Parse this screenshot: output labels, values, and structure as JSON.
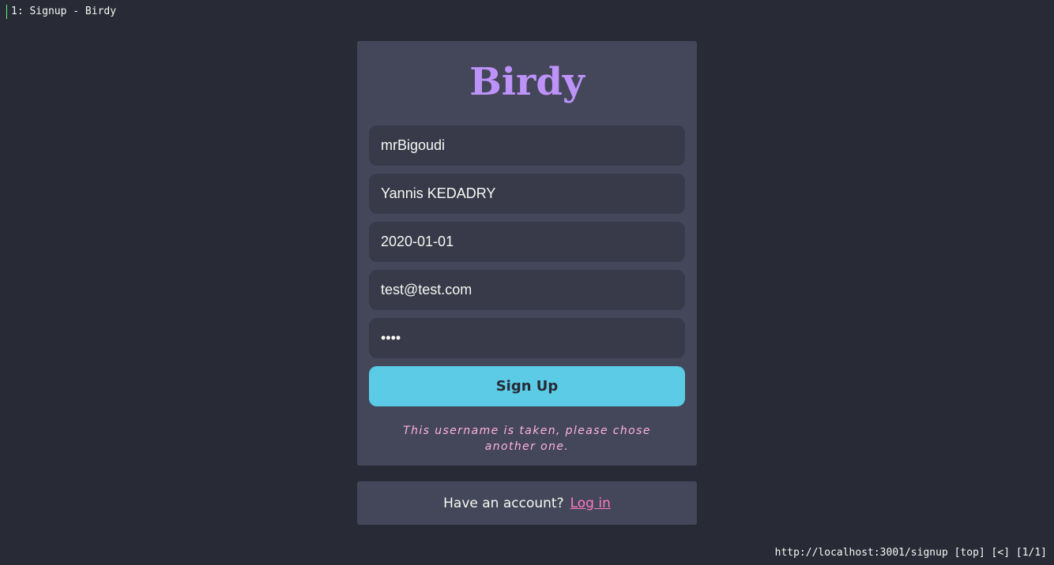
{
  "browser": {
    "tab_title": "1: Signup - Birdy",
    "status_bar": "http://localhost:3001/signup [top] [<] [1/1]"
  },
  "signup": {
    "logo": "Birdy",
    "fields": {
      "username": "mrBigoudi",
      "full_name": "Yannis KEDADRY",
      "birthdate": "2020-01-01",
      "email": "test@test.com",
      "password": "••••"
    },
    "submit_label": "Sign Up",
    "error_message": "This username is taken, please chose another one."
  },
  "login": {
    "prompt": "Have an account?",
    "link_label": "Log in"
  },
  "colors": {
    "background": "#282a36",
    "card": "#44475a",
    "accent_logo": "#bd93f9",
    "button": "#5bcbe6",
    "error": "#ffb2d9",
    "link": "#ff79c6"
  }
}
